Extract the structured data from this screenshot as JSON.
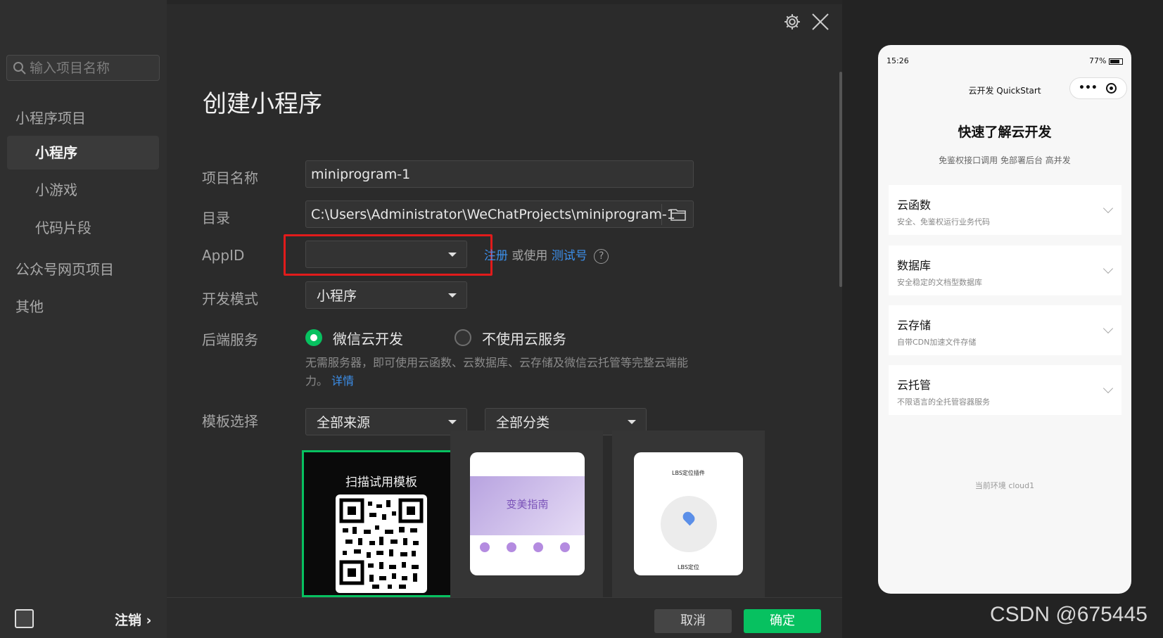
{
  "sidebar": {
    "search_placeholder": "输入项目名称",
    "group_miniprogram": "小程序项目",
    "items": [
      {
        "label": "小程序"
      },
      {
        "label": "小游戏"
      },
      {
        "label": "代码片段"
      }
    ],
    "group_official": "公众号网页项目",
    "group_other": "其他",
    "logout": "注销 ›"
  },
  "form": {
    "title": "创建小程序",
    "name_label": "项目名称",
    "name_value": "miniprogram-1",
    "dir_label": "目录",
    "dir_value": "C:\\Users\\Administrator\\WeChatProjects\\miniprogram-1",
    "appid_label": "AppID",
    "appid_value": "",
    "register_link": "注册",
    "or_use": "或使用",
    "test_account_link": "测试号",
    "help_icon_text": "?",
    "devmode_label": "开发模式",
    "devmode_value": "小程序",
    "backend_label": "后端服务",
    "backend_option_cloud": "微信云开发",
    "backend_option_none": "不使用云服务",
    "backend_desc": "无需服务器，即可使用云函数、云数据库、云存储及微信云托管等完整云端能力。",
    "details_link": "详情",
    "template_label": "模板选择",
    "template_source": "全部来源",
    "template_category": "全部分类",
    "template_scan_title": "扫描试用模板",
    "template2_banner": "变美指南",
    "template3_title": "LBS定位插件",
    "template3_caption": "LBS定位",
    "cancel_button": "取消",
    "confirm_button": "确定"
  },
  "preview": {
    "time": "15:26",
    "battery": "77%",
    "nav_title": "云开发 QuickStart",
    "heading": "快速了解云开发",
    "subheading": "免鉴权接口调用 免部署后台 高并发",
    "cards": [
      {
        "title": "云函数",
        "desc": "安全、免鉴权运行业务代码"
      },
      {
        "title": "数据库",
        "desc": "安全稳定的文档型数据库"
      },
      {
        "title": "云存储",
        "desc": "自带CDN加速文件存储"
      },
      {
        "title": "云托管",
        "desc": "不限语言的全托管容器服务"
      }
    ],
    "env": "当前环境 cloud1"
  },
  "watermark": "CSDN @675445",
  "colors": {
    "accent_green": "#07c160",
    "link_blue": "#3c8fea",
    "highlight_red": "#e11b1b"
  }
}
